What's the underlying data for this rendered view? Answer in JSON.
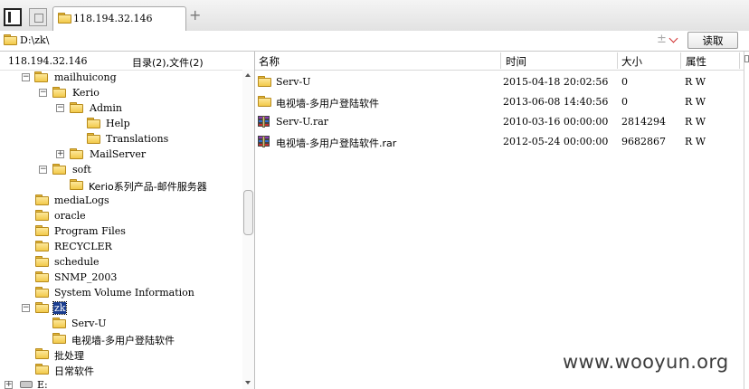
{
  "tab": {
    "label": "118.194.32.146",
    "add": "+"
  },
  "address": {
    "path": "D:\\zk\\",
    "pm": "±",
    "read_label": "读取"
  },
  "info": {
    "host": "118.194.32.146",
    "counts": "目录(2),文件(2)"
  },
  "tree": [
    {
      "label": "mailhuicong",
      "exp": "−"
    },
    {
      "label": "Kerio",
      "exp": "−"
    },
    {
      "label": "Admin",
      "exp": "−"
    },
    {
      "label": "Help",
      "exp": ""
    },
    {
      "label": "Translations",
      "exp": ""
    },
    {
      "label": "MailServer",
      "exp": "+"
    },
    {
      "label": "soft",
      "exp": "−"
    },
    {
      "label": "Kerio系列产品-邮件服务器",
      "exp": ""
    },
    {
      "label": "mediaLogs",
      "exp": ""
    },
    {
      "label": "oracle",
      "exp": ""
    },
    {
      "label": "Program Files",
      "exp": ""
    },
    {
      "label": "RECYCLER",
      "exp": ""
    },
    {
      "label": "schedule",
      "exp": ""
    },
    {
      "label": "SNMP_2003",
      "exp": ""
    },
    {
      "label": "System Volume Information",
      "exp": ""
    },
    {
      "label": "zk",
      "exp": "−",
      "selected": true
    },
    {
      "label": "Serv-U",
      "exp": ""
    },
    {
      "label": "电视墙-多用户登陆软件",
      "exp": ""
    },
    {
      "label": "批处理",
      "exp": ""
    },
    {
      "label": "日常软件",
      "exp": ""
    },
    {
      "label": "E:",
      "exp": "+",
      "drive": true
    }
  ],
  "columns": {
    "name": "名称",
    "time": "时间",
    "size": "大小",
    "attr": "属性"
  },
  "files": [
    {
      "name": "Serv-U",
      "time": "2015-04-18 20:02:56",
      "size": "0",
      "attr": "R W",
      "type": "folder"
    },
    {
      "name": "电视墙-多用户登陆软件",
      "time": "2013-06-08 14:40:56",
      "size": "0",
      "attr": "R W",
      "type": "folder"
    },
    {
      "name": "Serv-U.rar",
      "time": "2010-03-16 00:00:00",
      "size": "2814294",
      "attr": "R W",
      "type": "rar"
    },
    {
      "name": "电视墙-多用户登陆软件.rar",
      "time": "2012-05-24 00:00:00",
      "size": "9682867",
      "attr": "R W",
      "type": "rar"
    }
  ],
  "watermark": "www.wooyun.org"
}
